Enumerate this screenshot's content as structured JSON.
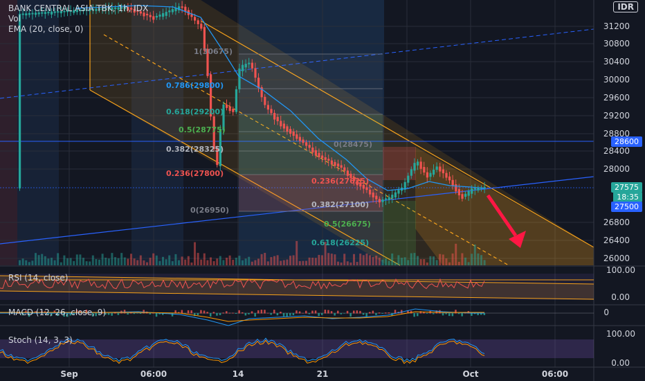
{
  "header": {
    "symbol": "BANK CENTRAL ASIA TBK, 1h, IDX",
    "vol": "Vol",
    "ema": "EMA (20, close, 0)",
    "currency": "IDR"
  },
  "price_axis": {
    "ticks": [
      "31200",
      "30800",
      "30400",
      "30000",
      "29600",
      "29200",
      "28800",
      "28400",
      "28000",
      "26800",
      "26400",
      "26000"
    ],
    "tag_upper": "28600",
    "tag_last": "27575",
    "tag_timer": "18:35",
    "tag_lower": "27500"
  },
  "fib_upper": {
    "labels": [
      "1(30675)",
      "0.786(29800)",
      "0.618(29200)",
      "0.5(28775)",
      "0.382(28325)",
      "0.236(27800)",
      "0(26950)"
    ]
  },
  "fib_lower": {
    "labels": [
      "0(28475)",
      "0.236(27625)",
      "0.382(27100)",
      "0.5(26675)",
      "0.618(26225)"
    ]
  },
  "rsi": {
    "label": "RSI (14, close)",
    "ticks": [
      "100.00",
      "0.00"
    ]
  },
  "macd": {
    "label": "MACD (12, 26, close, 9)",
    "ticks": [
      "0"
    ]
  },
  "stoch": {
    "label": "Stoch (14, 3, 3)",
    "ticks": [
      "100.00",
      "0.00"
    ]
  },
  "time_axis": {
    "labels": [
      "Sep",
      "06:00",
      "14",
      "21",
      "Oct",
      "06:00"
    ]
  },
  "colors": {
    "up": "#26a69a",
    "down": "#ef5350",
    "channel": "#f7a21b",
    "ema": "#2196f3",
    "trend": "#2962ff",
    "bg": "#131722"
  }
}
